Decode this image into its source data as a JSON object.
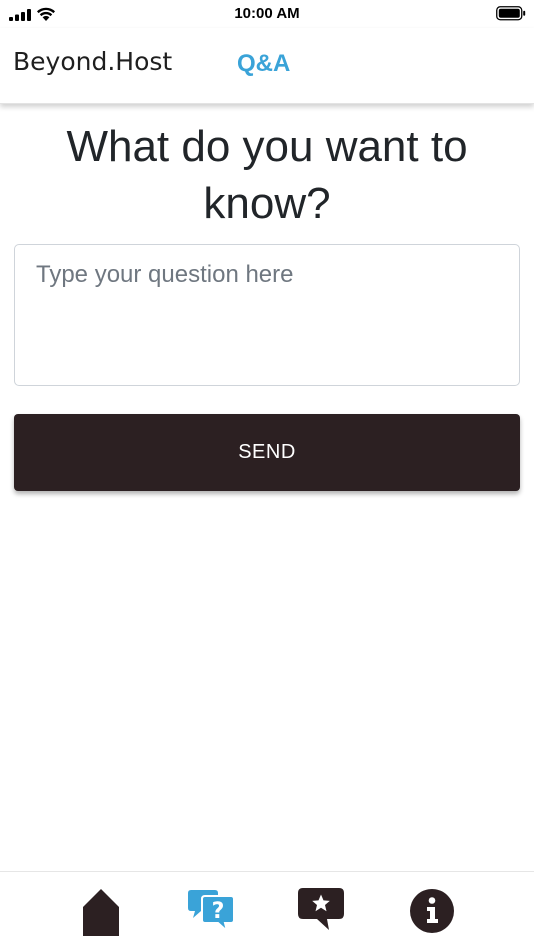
{
  "status_bar": {
    "time": "10:00 AM"
  },
  "header": {
    "brand": "Beyond.Host",
    "active_tab": "Q&A"
  },
  "main": {
    "title": "What do you want to know?",
    "input_placeholder": "Type your question here",
    "send_label": "SEND"
  },
  "tab_bar": {
    "items": [
      {
        "icon": "home-icon"
      },
      {
        "icon": "question-chat-icon"
      },
      {
        "icon": "star-chat-icon"
      },
      {
        "icon": "info-icon"
      }
    ]
  },
  "colors": {
    "accent": "#3aa3d8",
    "dark": "#2c2022"
  }
}
